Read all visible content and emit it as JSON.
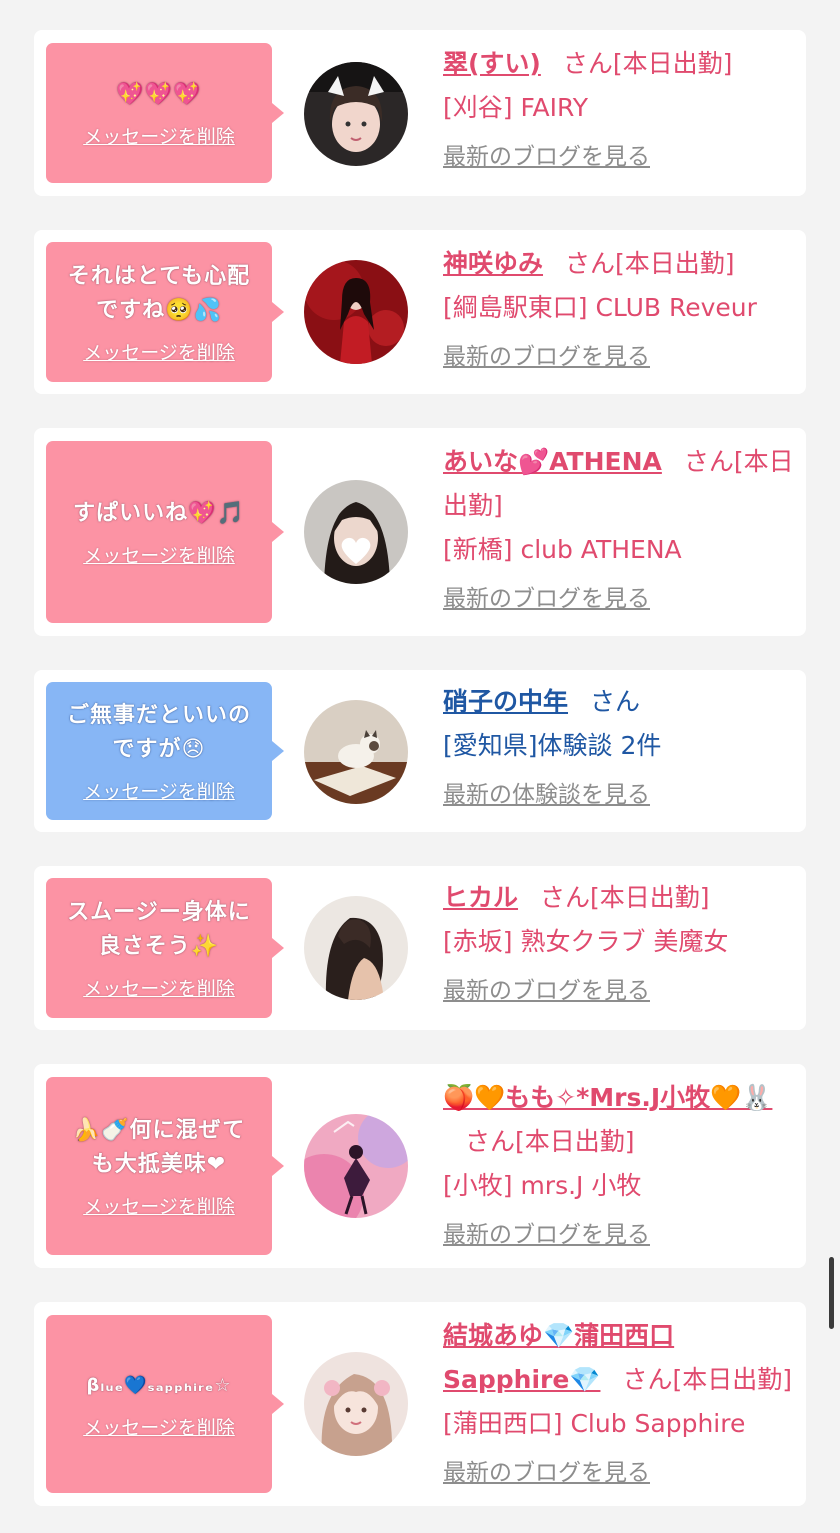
{
  "delete_label": "メッセージを削除",
  "san_label": "さん",
  "colors": {
    "pink_bubble": "#fc93a4",
    "blue_bubble": "#87b6f5",
    "pink_text": "#e04a6e",
    "blue_text": "#1f57a3",
    "link_gray": "#8d8d8d"
  },
  "items": [
    {
      "message": "💖💖💖",
      "name": "翠(すい)",
      "status": "[本日出勤]",
      "shop": "[刈谷] FAIRY",
      "link": "最新のブログを見る",
      "avatar": "avatar-photo-1"
    },
    {
      "message": "それはとても心配\nですね🥺💦",
      "name": "神咲ゆみ",
      "status": "[本日出勤]",
      "shop": "[綱島駅東口] CLUB Reveur",
      "link": "最新のブログを見る",
      "avatar": "avatar-photo-2"
    },
    {
      "message": "すぱいいね💖🎵",
      "name": "あいな💕ATHENA",
      "status": "[本日出勤]",
      "shop": "[新橋] club ATHENA",
      "link": "最新のブログを見る",
      "avatar": "avatar-photo-3"
    },
    {
      "message": "ご無事だといいの\nですが😞",
      "name": "硝子の中年",
      "status": "",
      "shop": "[愛知県]体験談 2件",
      "link": "最新の体験談を見る",
      "avatar": "avatar-photo-4"
    },
    {
      "message": "スムージー身体に\n良さそう✨",
      "name": "ヒカル",
      "status": "[本日出勤]",
      "shop": "[赤坂] 熟女クラブ 美魔女",
      "link": "最新のブログを見る",
      "avatar": "avatar-photo-5"
    },
    {
      "message": "🍌🍼何に混ぜて\nも大抵美味❤",
      "name": "🍑🧡もも✧*Mrs.J小牧🧡🐰",
      "status": "[本日出勤]",
      "shop": "[小牧] mrs.J 小牧",
      "link": "最新のブログを見る",
      "avatar": "avatar-photo-6"
    },
    {
      "message": "βₗᵤₑ💙ₛₐₚₚₕᵢᵣₑ☆",
      "name": "結城あゆ💎蒲田西口Sapphire💎",
      "status": "[本日出勤]",
      "shop": "[蒲田西口] Club Sapphire",
      "link": "最新のブログを見る",
      "avatar": "avatar-photo-7"
    }
  ]
}
